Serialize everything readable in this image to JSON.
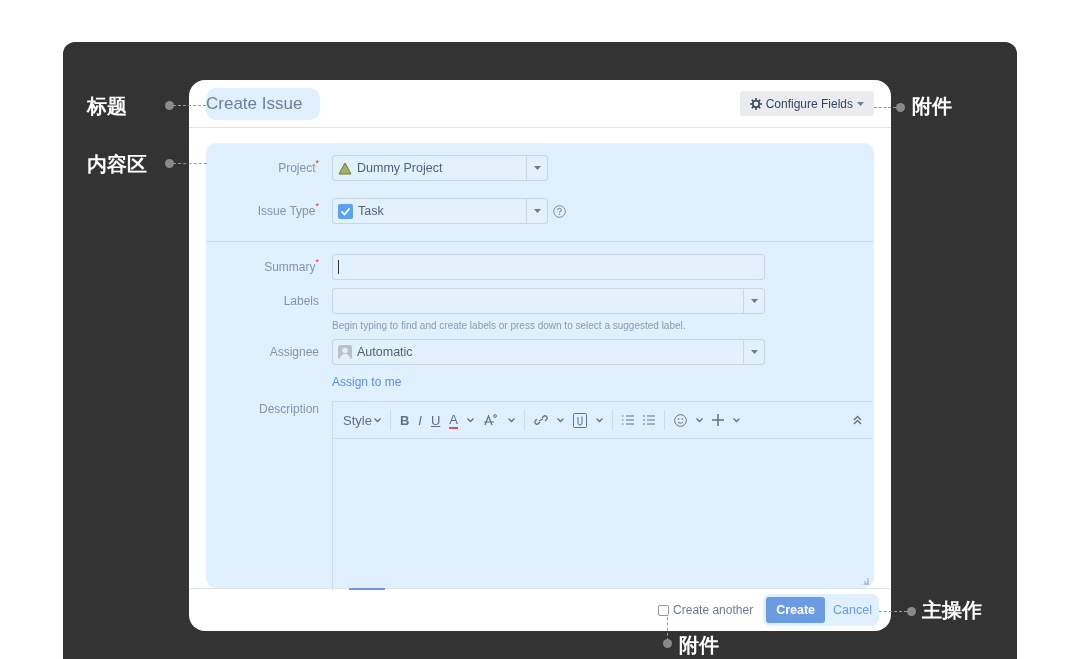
{
  "callouts": [
    {
      "text": "标题"
    },
    {
      "text": "内容区"
    },
    {
      "text": "附件"
    },
    {
      "text": "主操作"
    },
    {
      "text": "附件"
    }
  ],
  "dialog": {
    "title": "Create Issue",
    "configure_button": "Configure Fields",
    "sections": [
      [
        {
          "kind": "select",
          "label": "Project$^{*}$",
          "value": "Dummy Project"
        },
        {
          "kind": "select",
          "label": "Issue Type$^{*}$",
          "value": "Task",
          "help": true
        }
      ],
      [
        {
          "kind": "text",
          "label": "Summary$^{*}$"
        },
        {
          "kind": "select",
          "label": "Labels",
          "hint": "Begin typing to find and create labels or press down to select a suggested label."
        },
        {
          "kind": "select",
          "label": "Assignee",
          "value": "Automatic",
          "link": "Assign to me"
        },
        {
          "kind": "editor",
          "label": "Description",
          "style_label": "Style",
          "format_buttons": [
            "B",
            "I",
            "U",
            "A"
          ]
        }
      ]
    ],
    "create_another": {
      "label": "Create another",
      "checked": false
    },
    "primary_button": "Create",
    "cancel_link": "Cancel"
  }
}
